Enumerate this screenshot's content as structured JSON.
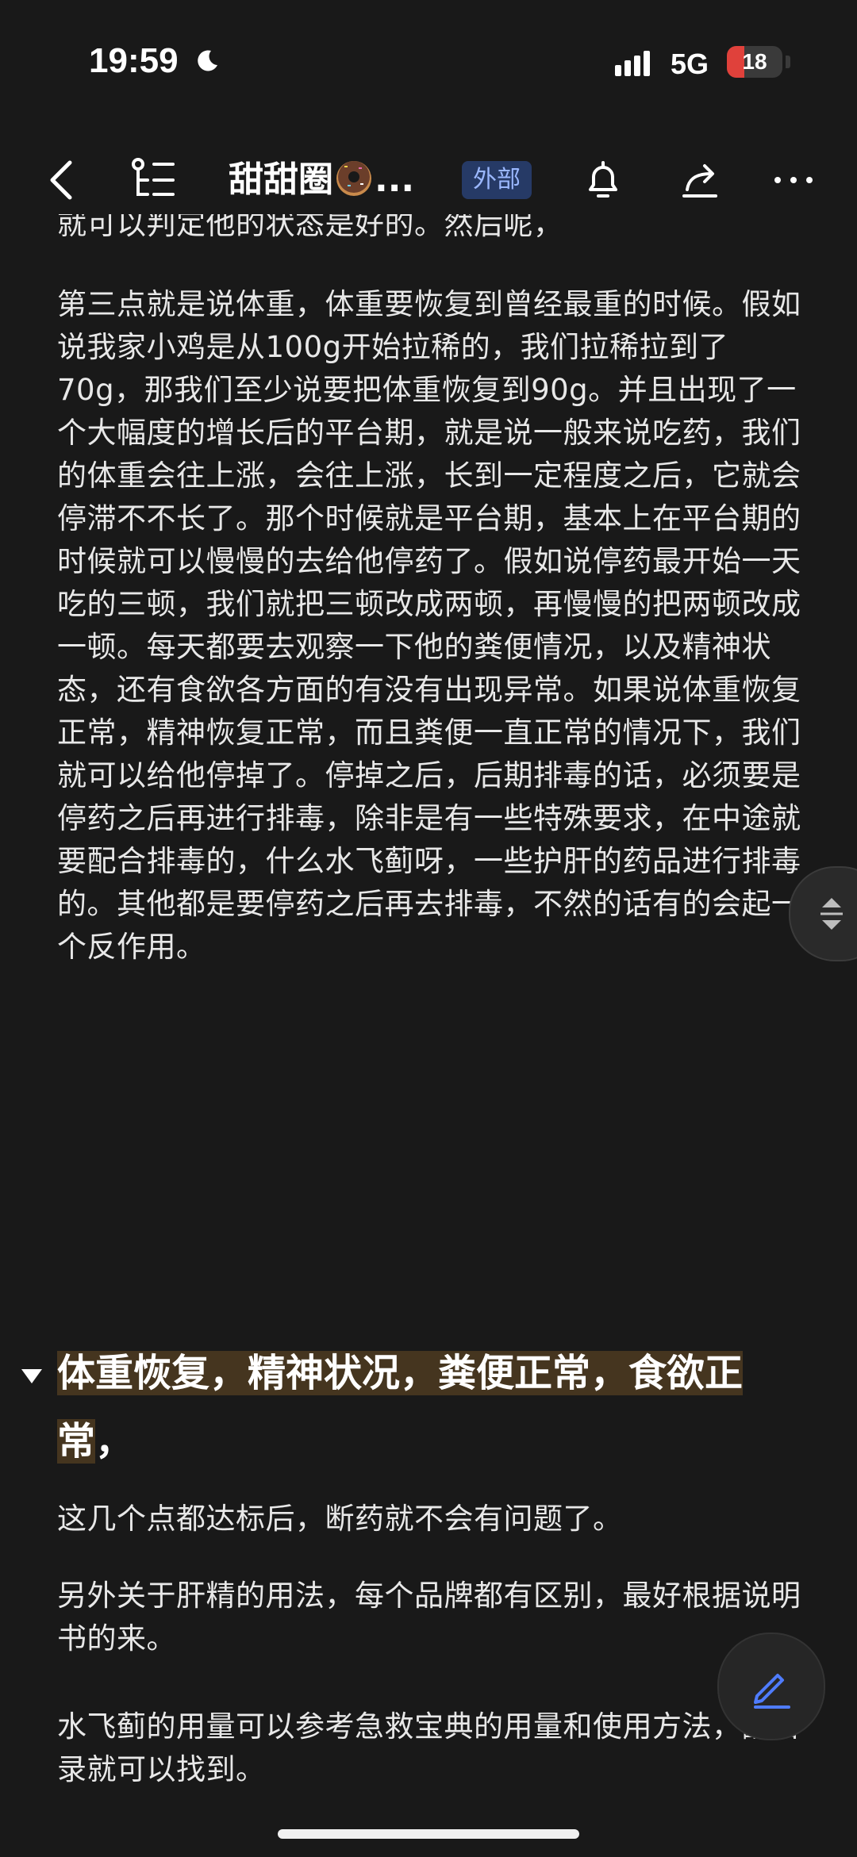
{
  "status_bar": {
    "time": "19:59",
    "network": "5G",
    "battery": "18"
  },
  "nav": {
    "title": "甜甜圈",
    "title_suffix": "...",
    "badge": "外部"
  },
  "content": {
    "partial_line": "就可以判定他的状态是好的。然后呢，",
    "paragraph1": "第三点就是说体重，体重要恢复到曾经最重的时候。假如说我家小鸡是从100g开始拉稀的，我们拉稀拉到了70g，那我们至少说要把体重恢复到90g。并且出现了一个大幅度的增长后的平台期，就是说一般来说吃药，我们的体重会往上涨，会往上涨，长到一定程度之后，它就会停滞不不长了。那个时候就是平台期，基本上在平台期的时候就可以慢慢的去给他停药了。假如说停药最开始一天吃的三顿，我们就把三顿改成两顿，再慢慢的把两顿改成一顿。每天都要去观察一下他的粪便情况，以及精神状态，还有食欲各方面的有没有出现异常。如果说体重恢复正常，精神恢复正常，而且粪便一直正常的情况下，我们就可以给他停掉了。停掉之后，后期排毒的话，必须要是停药之后再进行排毒，除非是有一些特殊要求，在中途就要配合排毒的，什么水飞蓟呀，一些护肝的药品进行排毒的。其他都是要停药之后再去排毒，不然的话有的会起一个反作用。",
    "heading_highlighted": "体重恢复，精神状况，粪便正常，食欲正常",
    "heading_tail": "，",
    "paragraph2": "这几个点都达标后，断药就不会有问题了。",
    "paragraph3": "另外关于肝精的用法，每个品牌都有区别，最好根据说明书的来。",
    "paragraph4": "水飞蓟的用量可以参考急救宝典的用量和使用方法，翻目录就可以找到。"
  }
}
